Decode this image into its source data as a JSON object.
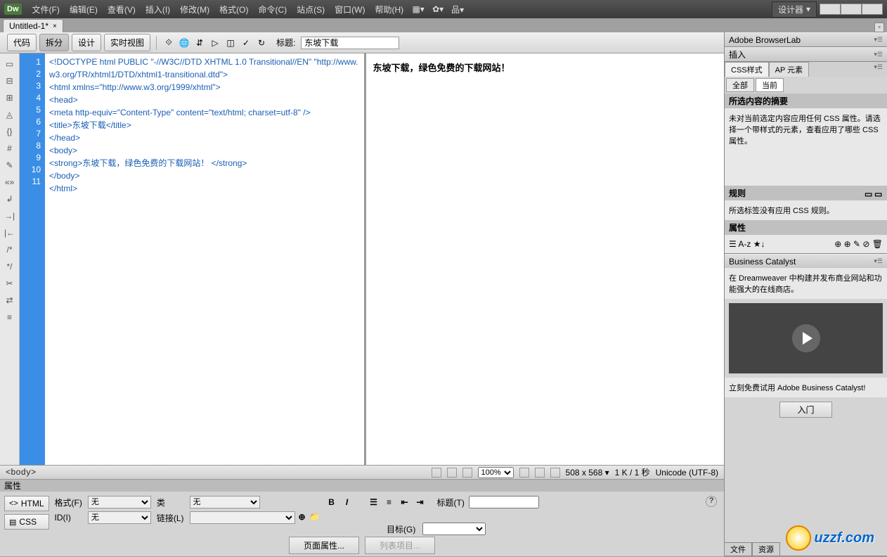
{
  "menu": {
    "items": [
      "文件(F)",
      "编辑(E)",
      "查看(V)",
      "插入(I)",
      "修改(M)",
      "格式(O)",
      "命令(C)",
      "站点(S)",
      "窗口(W)",
      "帮助(H)"
    ],
    "app_logo": "Dw",
    "designer": "设计器"
  },
  "doc_tab": {
    "name": "Untitled-1*"
  },
  "view_toolbar": {
    "code": "代码",
    "split": "拆分",
    "design": "设计",
    "live": "实时视图",
    "title_label": "标题:",
    "title_value": "东坡下载"
  },
  "code": {
    "lines": [
      "1",
      "2",
      "3",
      "4",
      "5",
      "6",
      "7",
      "8",
      "9",
      "10",
      "11"
    ],
    "l1": "<!DOCTYPE html PUBLIC \"-//W3C//DTD XHTML 1.0 Transitional//EN\" \"http://www.w3.org/TR/xhtml1/DTD/xhtml1-transitional.dtd\">",
    "l2": "<html xmlns=\"http://www.w3.org/1999/xhtml\">",
    "l3": "<head>",
    "l4": "<meta http-equiv=\"Content-Type\" content=\"text/html; charset=utf-8\" />",
    "l5": "<title>东坡下载</title>",
    "l6": "</head>",
    "l7": "<body>",
    "l8": "<strong>东坡下载，绿色免费的下载网站！ </strong>",
    "l9": "</body>",
    "l10": "</html>"
  },
  "design_text": "东坡下载，绿色免费的下载网站！",
  "status": {
    "tag_selector": "<body>",
    "zoom": "100%",
    "dimensions": "508 x 568",
    "size_time": "1 K / 1 秒",
    "encoding": "Unicode (UTF-8)"
  },
  "props": {
    "header": "属性",
    "html_btn": "HTML",
    "css_btn": "CSS",
    "format_label": "格式(F)",
    "format_value": "无",
    "id_label": "ID(I)",
    "id_value": "无",
    "class_label": "类",
    "class_value": "无",
    "link_label": "链接(L)",
    "title_label": "标题(T)",
    "target_label": "目标(G)",
    "page_props": "页面属性...",
    "list_items": "列表项目..."
  },
  "right": {
    "browserlab": "Adobe BrowserLab",
    "insert": "插入",
    "css_styles": "CSS样式",
    "ap_elements": "AP 元素",
    "all": "全部",
    "current": "当前",
    "summary_hdr": "所选内容的摘要",
    "summary_text": "未对当前选定内容应用任何 CSS 属性。请选择一个带样式的元素，查看应用了哪些 CSS 属性。",
    "rules_hdr": "规则",
    "rules_text": "所选标签没有应用 CSS 规则。",
    "attrs_hdr": "属性",
    "bc_header": "Business Catalyst",
    "bc_text1": "在 Dreamweaver 中构建并发布商业网站和功能强大的在线商店。",
    "bc_text2": "立刻免费试用 Adobe Business Catalyst!",
    "enter": "入门",
    "files_tab": "文件",
    "assets_tab": "资源"
  },
  "watermark": "uzzf.com"
}
